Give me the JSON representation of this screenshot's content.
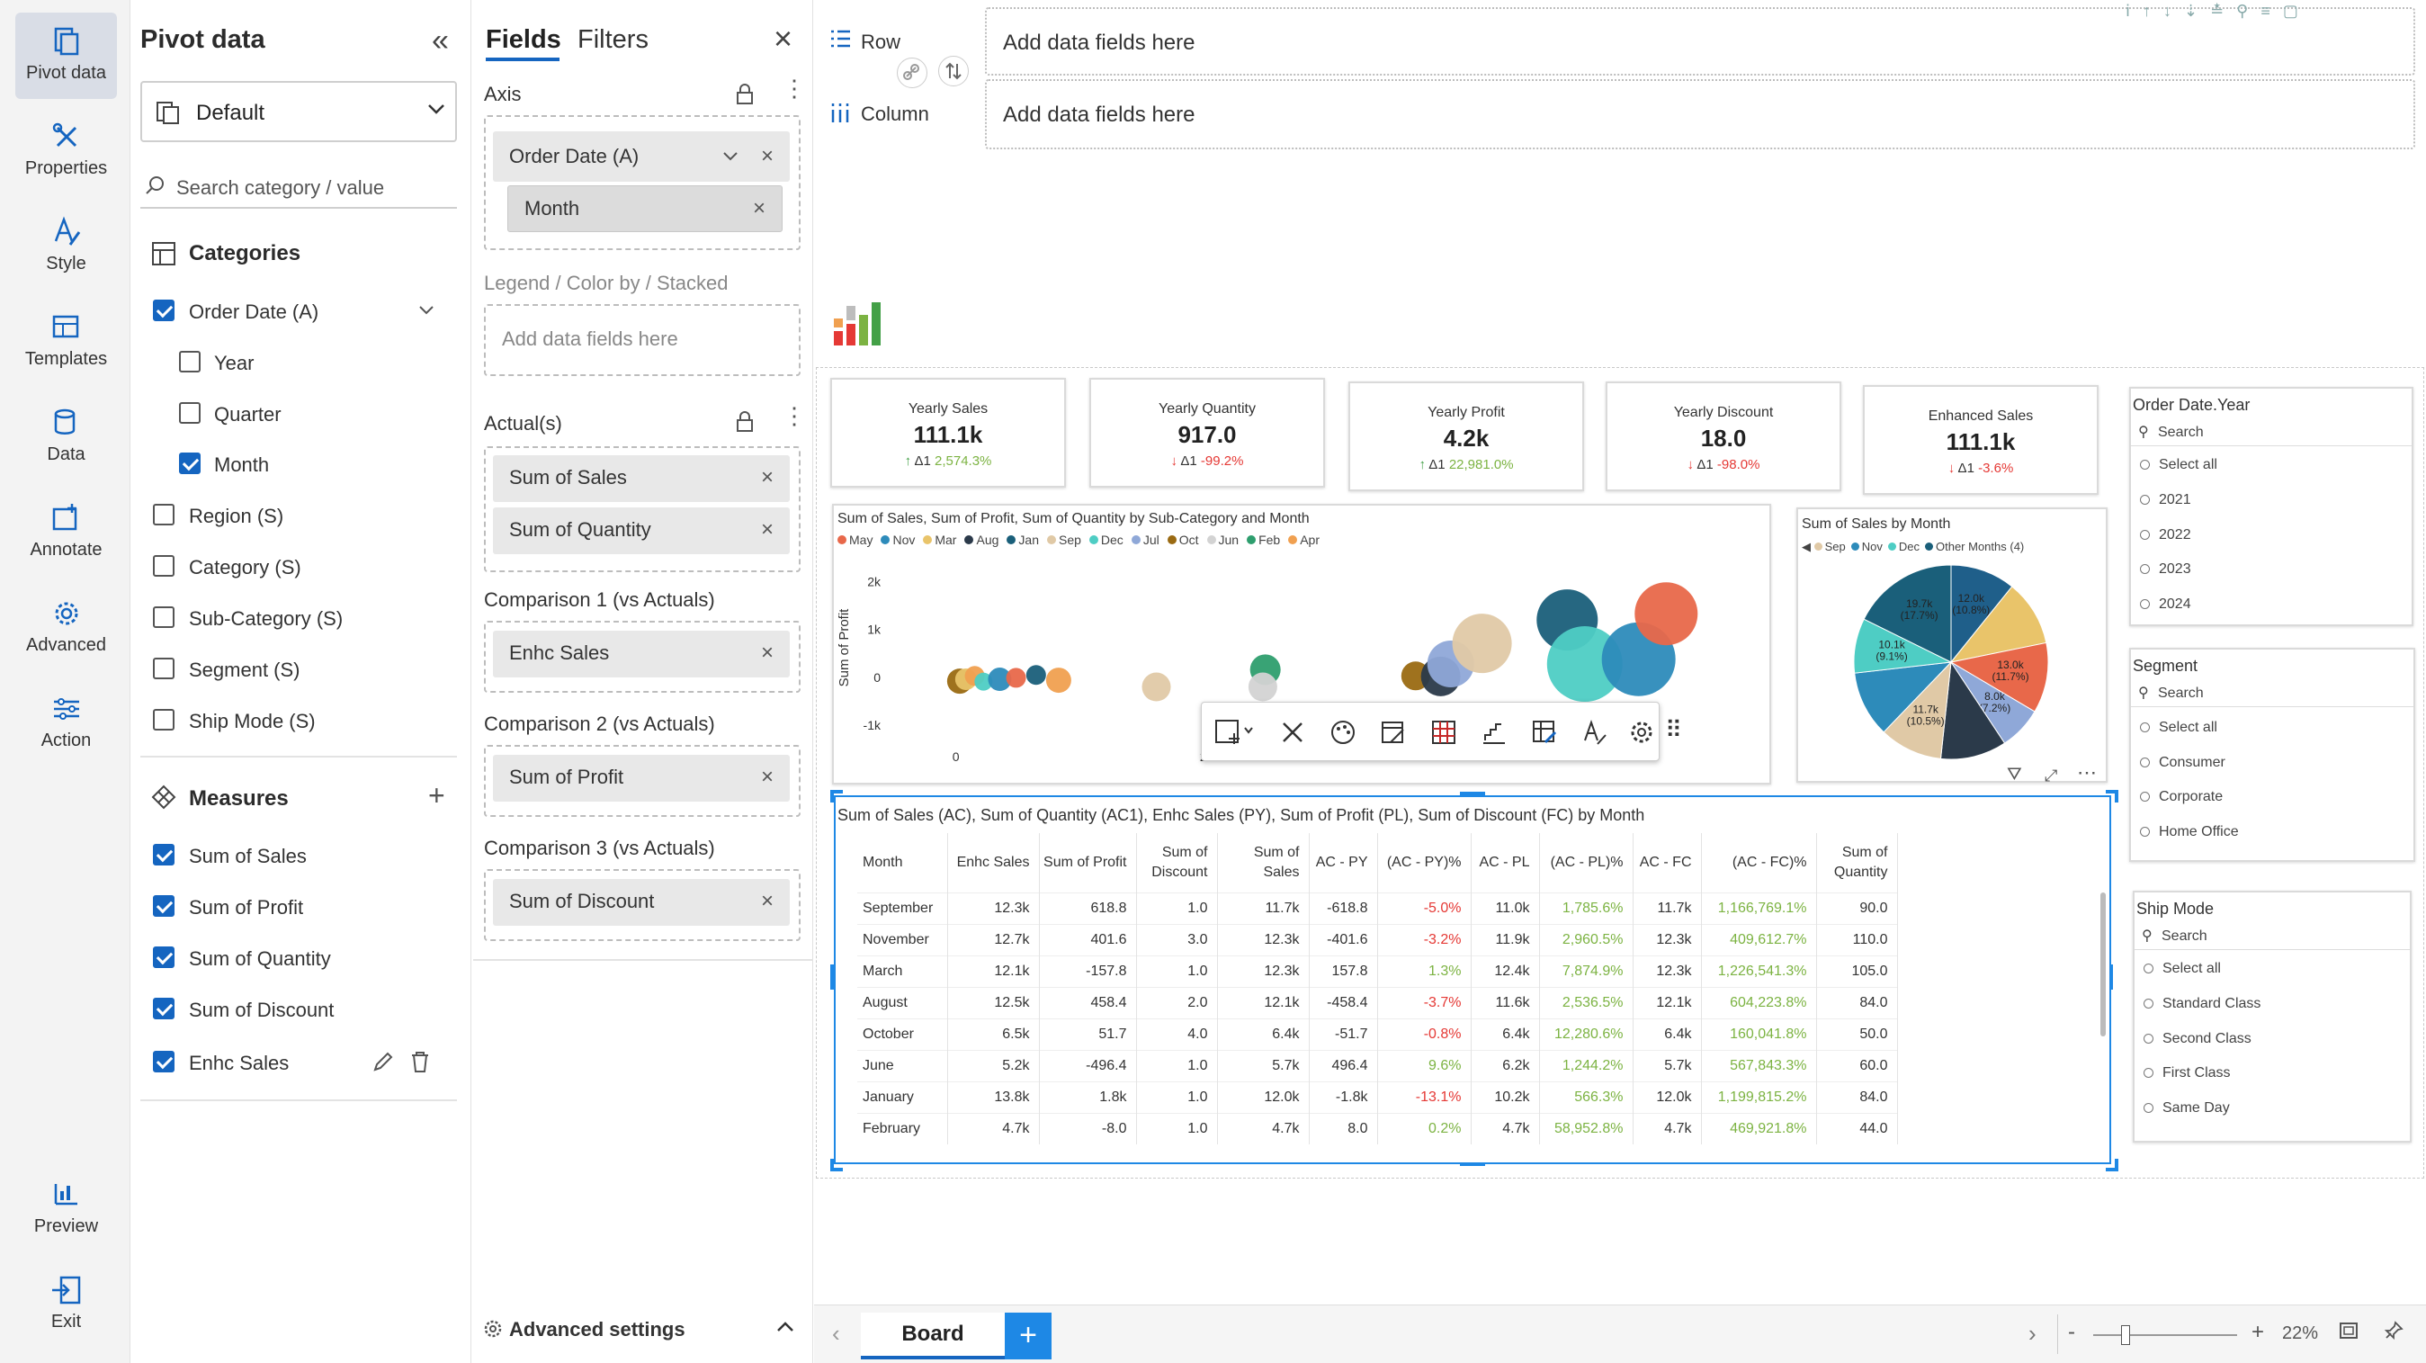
{
  "rail": {
    "items": [
      {
        "label": "Pivot data",
        "icon": "pivot-icon"
      },
      {
        "label": "Properties",
        "icon": "tools-icon"
      },
      {
        "label": "Style",
        "icon": "style-icon"
      },
      {
        "label": "Templates",
        "icon": "templates-icon"
      },
      {
        "label": "Data",
        "icon": "database-icon"
      },
      {
        "label": "Annotate",
        "icon": "annotate-icon"
      },
      {
        "label": "Advanced",
        "icon": "gear-icon"
      },
      {
        "label": "Action",
        "icon": "sliders-icon"
      }
    ],
    "bottom": [
      {
        "label": "Preview",
        "icon": "preview-icon"
      },
      {
        "label": "Exit",
        "icon": "exit-icon"
      }
    ]
  },
  "pivot": {
    "title": "Pivot data",
    "dataset": "Default",
    "search_placeholder": "Search category / value",
    "categories_title": "Categories",
    "categories": [
      {
        "label": "Order Date (A)",
        "checked": true
      },
      {
        "label": "Year",
        "checked": false
      },
      {
        "label": "Quarter",
        "checked": false
      },
      {
        "label": "Month",
        "checked": true
      },
      {
        "label": "Region (S)",
        "checked": false
      },
      {
        "label": "Category (S)",
        "checked": false
      },
      {
        "label": "Sub-Category (S)",
        "checked": false
      },
      {
        "label": "Segment (S)",
        "checked": false
      },
      {
        "label": "Ship Mode (S)",
        "checked": false
      }
    ],
    "measures_title": "Measures",
    "measures": [
      {
        "label": "Sum of Sales",
        "checked": true
      },
      {
        "label": "Sum of Profit",
        "checked": true
      },
      {
        "label": "Sum of Quantity",
        "checked": true
      },
      {
        "label": "Sum of Discount",
        "checked": true
      },
      {
        "label": "Enhc Sales",
        "checked": true
      }
    ]
  },
  "fields": {
    "tab_fields": "Fields",
    "tab_filters": "Filters",
    "axis_label": "Axis",
    "axis_field": "Order Date (A)",
    "axis_sub": "Month",
    "legend_label": "Legend / Color by / Stacked",
    "legend_placeholder": "Add data fields here",
    "actuals_label": "Actual(s)",
    "actuals": [
      "Sum of Sales",
      "Sum of Quantity"
    ],
    "comp1_label": "Comparison 1 (vs Actuals)",
    "comp1": "Enhc Sales",
    "comp2_label": "Comparison 2 (vs Actuals)",
    "comp2": "Sum of Profit",
    "comp3_label": "Comparison 3 (vs Actuals)",
    "comp3": "Sum of Discount",
    "advanced": "Advanced settings"
  },
  "shelf": {
    "row_label": "Row",
    "column_label": "Column",
    "row_placeholder": "Add data fields here",
    "column_placeholder": "Add data fields here"
  },
  "kpis": [
    {
      "title": "Yearly Sales",
      "value": "111.1k",
      "delta_label": "Δ1",
      "delta": "2,574.3%",
      "direction": "up"
    },
    {
      "title": "Yearly Quantity",
      "value": "917.0",
      "delta_label": "Δ1",
      "delta": "-99.2%",
      "direction": "down"
    },
    {
      "title": "Yearly Profit",
      "value": "4.2k",
      "delta_label": "Δ1",
      "delta": "22,981.0%",
      "direction": "up"
    },
    {
      "title": "Yearly Discount",
      "value": "18.0",
      "delta_label": "Δ1",
      "delta": "-98.0%",
      "direction": "down"
    },
    {
      "title": "Enhanced Sales",
      "value": "111.1k",
      "delta_label": "Δ1",
      "delta": "-3.6%",
      "direction": "down"
    }
  ],
  "chart_data": [
    {
      "type": "scatter",
      "title": "Sum of Sales, Sum of Profit, Sum of Quantity by Sub-Category and Month",
      "ylabel": "Sum of Profit",
      "xlabel": "",
      "x_ticks": [
        "0",
        "2k",
        "4k"
      ],
      "y_ticks": [
        "2k",
        "1k",
        "0",
        "-1k"
      ],
      "legend": [
        {
          "name": "May",
          "color": "#e8684a"
        },
        {
          "name": "Nov",
          "color": "#2d8bba"
        },
        {
          "name": "Mar",
          "color": "#e9c46a"
        },
        {
          "name": "Aug",
          "color": "#2b3a4a"
        },
        {
          "name": "Jan",
          "color": "#1a5f7a"
        },
        {
          "name": "Sep",
          "color": "#e0c9a6"
        },
        {
          "name": "Dec",
          "color": "#4ecdc4"
        },
        {
          "name": "Jul",
          "color": "#8fa8d8"
        },
        {
          "name": "Oct",
          "color": "#9a6a12"
        },
        {
          "name": "Jun",
          "color": "#d3d3d3"
        },
        {
          "name": "Feb",
          "color": "#2e9e6e"
        },
        {
          "name": "Apr",
          "color": "#f0a050"
        }
      ],
      "points": [
        {
          "x": 30,
          "y": -80,
          "r": 14,
          "color": "#9a6a12"
        },
        {
          "x": 80,
          "y": -40,
          "r": 12,
          "color": "#e9c46a"
        },
        {
          "x": 150,
          "y": 30,
          "r": 11,
          "color": "#f0a050"
        },
        {
          "x": 220,
          "y": -90,
          "r": 10,
          "color": "#4ecdc4"
        },
        {
          "x": 350,
          "y": -40,
          "r": 13,
          "color": "#2d8bba"
        },
        {
          "x": 480,
          "y": -10,
          "r": 11,
          "color": "#e8684a"
        },
        {
          "x": 640,
          "y": 50,
          "r": 11,
          "color": "#1a5f7a"
        },
        {
          "x": 820,
          "y": -60,
          "r": 14,
          "color": "#f0a050"
        },
        {
          "x": 1600,
          "y": -200,
          "r": 16,
          "color": "#e0c9a6"
        },
        {
          "x": 2470,
          "y": 160,
          "r": 17,
          "color": "#2e9e6e"
        },
        {
          "x": 2450,
          "y": -200,
          "r": 16,
          "color": "#d3d3d3"
        },
        {
          "x": 3670,
          "y": 30,
          "r": 16,
          "color": "#9a6a12"
        },
        {
          "x": 3870,
          "y": 20,
          "r": 22,
          "color": "#2b3a4a"
        },
        {
          "x": 3950,
          "y": 280,
          "r": 26,
          "color": "#8fa8d8"
        },
        {
          "x": 4200,
          "y": 710,
          "r": 33,
          "color": "#e0c9a6"
        },
        {
          "x": 4880,
          "y": 1200,
          "r": 34,
          "color": "#1a5f7a"
        },
        {
          "x": 5020,
          "y": 280,
          "r": 42,
          "color": "#4ecdc4"
        },
        {
          "x": 5450,
          "y": 380,
          "r": 41,
          "color": "#2d8bba"
        },
        {
          "x": 5670,
          "y": 1330,
          "r": 35,
          "color": "#e8684a"
        }
      ],
      "xlim": [
        -400,
        6350
      ],
      "ylim": [
        -1300,
        2500
      ]
    },
    {
      "type": "pie",
      "title": "Sum of Sales by Month",
      "legend": [
        {
          "name": "Sep",
          "color": "#e0c9a6"
        },
        {
          "name": "Nov",
          "color": "#2d8bba"
        },
        {
          "name": "Dec",
          "color": "#4ecdc4"
        },
        {
          "name": "Other Months (4)",
          "color": "#1a5f7a"
        }
      ],
      "slices": [
        {
          "label": "12.0k\n(10.8%)",
          "value": 10.8,
          "color": "#1f5f8a"
        },
        {
          "label": "",
          "value": 11.0,
          "color": "#e9c46a"
        },
        {
          "label": "13.0k\n(11.7%)",
          "value": 11.7,
          "color": "#e8684a"
        },
        {
          "label": "8.0k\n(7.2%)",
          "value": 7.2,
          "color": "#8fa8d8"
        },
        {
          "label": "",
          "value": 11.0,
          "color": "#2b3a4a"
        },
        {
          "label": "11.7k\n(10.5%)",
          "value": 10.5,
          "color": "#e0c9a6"
        },
        {
          "label": "",
          "value": 11.0,
          "color": "#2d8bba"
        },
        {
          "label": "10.1k\n(9.1%)",
          "value": 9.1,
          "color": "#4ecdc4"
        },
        {
          "label": "19.7k\n(17.7%)",
          "value": 17.7,
          "color": "#1a5f7a"
        }
      ]
    }
  ],
  "table": {
    "title": "Sum of Sales (AC), Sum of Quantity (AC1), Enhc Sales (PY), Sum of Profit (PL), Sum of Discount (FC) by Month",
    "columns": [
      "Month",
      "Enhc Sales",
      "Sum of Profit",
      "Sum of\nDiscount",
      "Sum of Sales",
      "AC - PY",
      "(AC - PY)%",
      "AC - PL",
      "(AC - PL)%",
      "AC - FC",
      "(AC - FC)%",
      "Sum of\nQuantity"
    ],
    "rows": [
      [
        "September",
        "12.3k",
        "618.8",
        "1.0",
        "11.7k",
        "-618.8",
        "-5.0%",
        "11.0k",
        "1,785.6%",
        "11.7k",
        "1,166,769.1%",
        "90.0"
      ],
      [
        "November",
        "12.7k",
        "401.6",
        "3.0",
        "12.3k",
        "-401.6",
        "-3.2%",
        "11.9k",
        "2,960.5%",
        "12.3k",
        "409,612.7%",
        "110.0"
      ],
      [
        "March",
        "12.1k",
        "-157.8",
        "1.0",
        "12.3k",
        "157.8",
        "1.3%",
        "12.4k",
        "7,874.9%",
        "12.3k",
        "1,226,541.3%",
        "105.0"
      ],
      [
        "August",
        "12.5k",
        "458.4",
        "2.0",
        "12.1k",
        "-458.4",
        "-3.7%",
        "11.6k",
        "2,536.5%",
        "12.1k",
        "604,223.8%",
        "84.0"
      ],
      [
        "October",
        "6.5k",
        "51.7",
        "4.0",
        "6.4k",
        "-51.7",
        "-0.8%",
        "6.4k",
        "12,280.6%",
        "6.4k",
        "160,041.8%",
        "50.0"
      ],
      [
        "June",
        "5.2k",
        "-496.4",
        "1.0",
        "5.7k",
        "496.4",
        "9.6%",
        "6.2k",
        "1,244.2%",
        "5.7k",
        "567,843.3%",
        "60.0"
      ],
      [
        "January",
        "13.8k",
        "1.8k",
        "1.0",
        "12.0k",
        "-1.8k",
        "-13.1%",
        "10.2k",
        "566.3%",
        "12.0k",
        "1,199,815.2%",
        "84.0"
      ],
      [
        "February",
        "4.7k",
        "-8.0",
        "1.0",
        "4.7k",
        "8.0",
        "0.2%",
        "4.7k",
        "58,952.8%",
        "4.7k",
        "469,921.8%",
        "44.0"
      ]
    ]
  },
  "slicers": [
    {
      "title": "Order Date.Year",
      "search": "Search",
      "items": [
        "Select all",
        "2021",
        "2022",
        "2023",
        "2024"
      ]
    },
    {
      "title": "Segment",
      "search": "Search",
      "items": [
        "Select all",
        "Consumer",
        "Corporate",
        "Home Office"
      ]
    },
    {
      "title": "Ship Mode",
      "search": "Search",
      "items": [
        "Select all",
        "Standard Class",
        "Second Class",
        "First Class",
        "Same Day"
      ]
    }
  ],
  "bottom_bar": {
    "tab": "Board",
    "add": "+",
    "zoom": "22%",
    "zoom_minus": "-",
    "zoom_plus": "+"
  }
}
